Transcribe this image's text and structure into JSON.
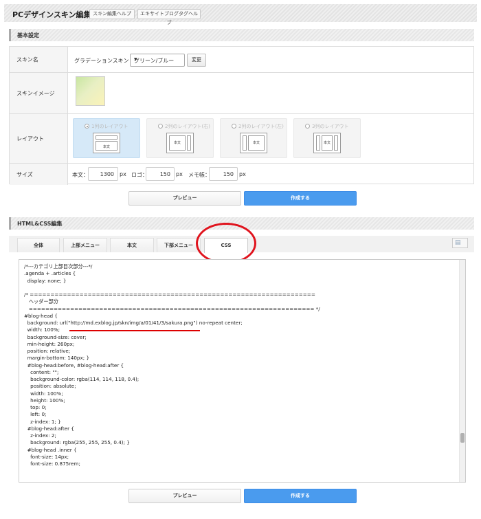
{
  "header": {
    "title": "PCデザインスキン編集",
    "help_buttons": [
      "スキン編集ヘルプ",
      "エキサイトブログタグヘルプ"
    ]
  },
  "basic": {
    "section_title": "基本設定",
    "skin_name": {
      "label": "スキン名",
      "prefix": "グラデーションスキン ：",
      "selected": "グリーン/ブルー",
      "change_button": "変更"
    },
    "skin_image": {
      "label": "スキンイメージ"
    },
    "layout": {
      "label": "レイアウト",
      "options": [
        {
          "label": "1列のレイアウト",
          "body_text": "本文"
        },
        {
          "label": "2列のレイアウト(右)",
          "body_text": "本文"
        },
        {
          "label": "2列のレイアウト(左)",
          "body_text": "本文"
        },
        {
          "label": "3列のレイアウト",
          "body_text": "本文"
        }
      ]
    },
    "size": {
      "label": "サイズ",
      "body_label": "本文：",
      "body_value": "1300",
      "logo_label": "ロゴ：",
      "logo_value": "150",
      "memo_label": "メモ帳：",
      "memo_value": "150",
      "unit": "px"
    }
  },
  "actions": {
    "preview": "プレビュー",
    "create": "作成する"
  },
  "editor": {
    "section_title": "HTML&CSS編集",
    "tabs": [
      "全体",
      "上部メニュー",
      "本文",
      "下部メニュー",
      "CSS"
    ],
    "active_tab": "CSS",
    "code": "/*---カテゴリ上部目次部分---*/\n.agenda + .articles {\n  display: none; }\n\n/* =====================================================================\n   ヘッダー部分\n   ===================================================================== */\n#blog-head {\n  background: url(\"http://md.exblog.jp/skn/img/a/01/41/3/sakura.png\") no-repeat center;\n  width: 100%;\n  background-size: cover;\n  min-height: 260px;\n  position: relative;\n  margin-bottom: 140px; }\n  #blog-head:before, #blog-head:after {\n    content: \"\";\n    background-color: rgba(114, 114, 118, 0.4);\n    position: absolute;\n    width: 100%;\n    height: 100%;\n    top: 0;\n    left: 0;\n    z-index: 1; }\n  #blog-head:after {\n    z-index: 2;\n    background: rgba(255, 255, 255, 0.4); }\n  #blog-head .inner {\n    font-size: 14px;\n    font-size: 0.875rem;"
  },
  "colors": {
    "primary_button": "#4a9bee",
    "selected_layout": "#d6e9f8",
    "annotation_red": "#e0141e"
  }
}
